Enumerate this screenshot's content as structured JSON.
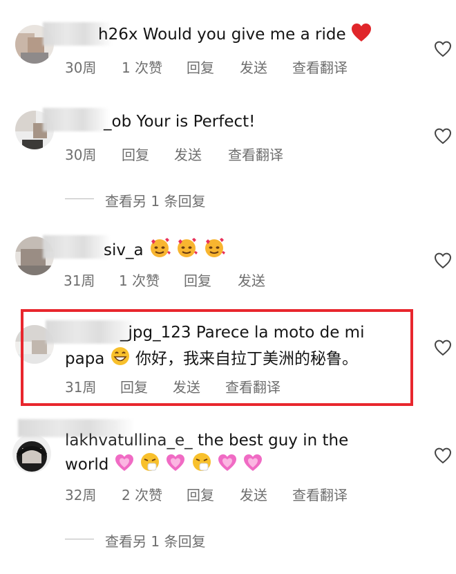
{
  "comments": [
    {
      "username_visible": "h26x",
      "text": "Would you give me a ride",
      "emoji": "heart",
      "time": "30周",
      "likes": "1 次赞",
      "reply": "回复",
      "send": "发送",
      "translate": "查看翻译"
    },
    {
      "username_visible": "_ob",
      "text": "Your is Perfect!",
      "time": "30周",
      "reply": "回复",
      "send": "发送",
      "translate": "查看翻译",
      "more_replies": "查看另 1 条回复"
    },
    {
      "username_visible": "siv_a",
      "text": "",
      "emoji": "smiling-face-with-hearts x3",
      "time": "31周",
      "likes": "1 次赞",
      "reply": "回复",
      "send": "发送"
    },
    {
      "username_visible": "_jpg_123",
      "text_line1": "Parece la moto de mi",
      "text_line2_a": "papa",
      "text_line2_b": "你好，我来自拉丁美洲的秘鲁。",
      "emoji": "grinning-face",
      "time": "31周",
      "reply": "回复",
      "send": "发送",
      "translate": "查看翻译"
    },
    {
      "username_visible": "lakhvatullina_e_",
      "text_line1": "the best guy in the",
      "text_line2": "world",
      "emoji": "growing-heart, sneezing-face, growing-heart, sneezing-face, growing-heart, growing-heart",
      "time": "32周",
      "likes": "2 次赞",
      "reply": "回复",
      "send": "发送",
      "translate": "查看翻译",
      "more_replies": "查看另 1 条回复"
    }
  ],
  "colors": {
    "highlight": "#e8262d",
    "meta_text": "#6e6e6e",
    "heart_red": "#e0262a",
    "pink_heart": "#f06bc4"
  }
}
